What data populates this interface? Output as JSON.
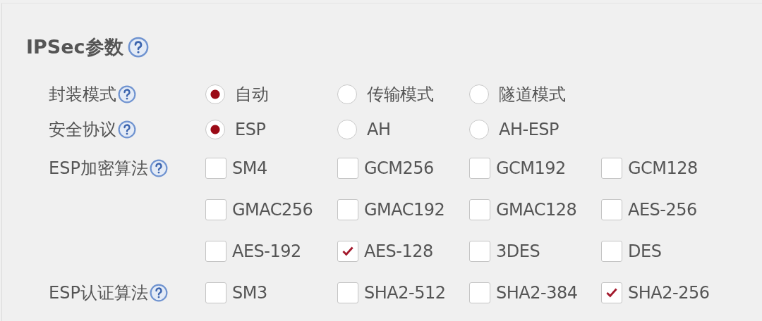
{
  "section": {
    "title": "IPSec参数"
  },
  "fields": [
    {
      "label": "封装模式",
      "kind": "radio",
      "options": [
        {
          "label": "自动",
          "selected": true
        },
        {
          "label": "传输模式",
          "selected": false
        },
        {
          "label": "隧道模式",
          "selected": false
        }
      ]
    },
    {
      "label": "安全协议",
      "kind": "radio",
      "options": [
        {
          "label": "ESP",
          "selected": true
        },
        {
          "label": "AH",
          "selected": false
        },
        {
          "label": "AH-ESP",
          "selected": false
        }
      ]
    },
    {
      "label": "ESP加密算法",
      "kind": "checkbox",
      "options": [
        {
          "label": "SM4",
          "checked": false
        },
        {
          "label": "GCM256",
          "checked": false
        },
        {
          "label": "GCM192",
          "checked": false
        },
        {
          "label": "GCM128",
          "checked": false
        },
        {
          "label": "GMAC256",
          "checked": false
        },
        {
          "label": "GMAC192",
          "checked": false
        },
        {
          "label": "GMAC128",
          "checked": false
        },
        {
          "label": "AES-256",
          "checked": false
        },
        {
          "label": "AES-192",
          "checked": false
        },
        {
          "label": "AES-128",
          "checked": true
        },
        {
          "label": "3DES",
          "checked": false
        },
        {
          "label": "DES",
          "checked": false
        }
      ]
    },
    {
      "label": "ESP认证算法",
      "kind": "checkbox",
      "options": [
        {
          "label": "SM3",
          "checked": false
        },
        {
          "label": "SHA2-512",
          "checked": false
        },
        {
          "label": "SHA2-384",
          "checked": false
        },
        {
          "label": "SHA2-256",
          "checked": true
        }
      ]
    }
  ]
}
